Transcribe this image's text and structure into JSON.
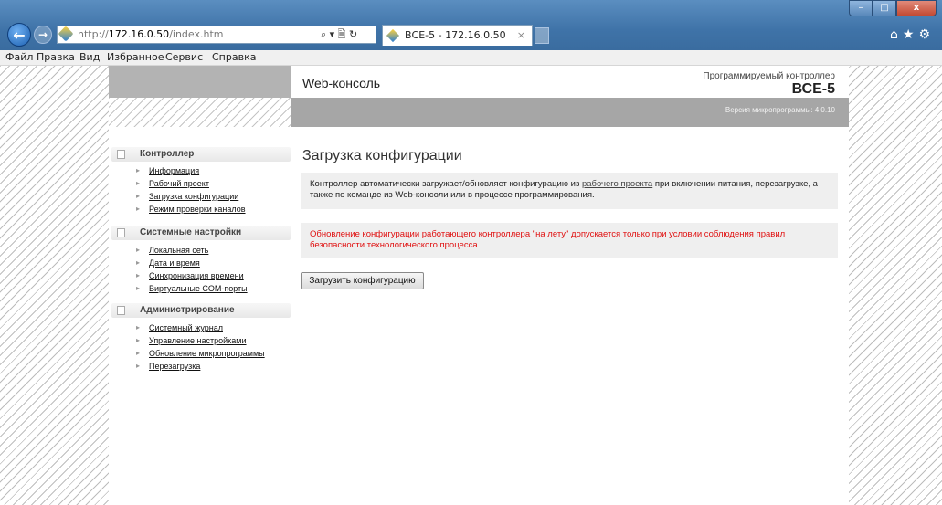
{
  "browser": {
    "url_prefix": "http://",
    "url_host": "172.16.0.50",
    "url_path": "/index.htm",
    "address_tools": "⌕ ▾ 🗎 ↻",
    "tab_title": "ВСЕ-5 - 172.16.0.50",
    "tab_close": "×",
    "back_icon": "arrow-left-icon",
    "forward_icon": "arrow-right-icon",
    "home_icon": "⌂",
    "favorites_icon": "★",
    "settings_icon": "⚙",
    "window_minimize": "–",
    "window_maximize": "□",
    "window_close": "x"
  },
  "menubar": {
    "items": [
      "Файл",
      "Правка",
      "Вид",
      "Избранное",
      "Сервис",
      "Справка"
    ]
  },
  "header": {
    "console_title": "Web-консоль",
    "controller_type": "Программируемый контроллер",
    "device_name": "ВСЕ-5",
    "firmware_version": "Версия микропрограммы: 4.0.10"
  },
  "sidebar": {
    "sections": [
      {
        "title": "Контроллер",
        "items": [
          "Информация",
          "Рабочий проект",
          "Загрузка конфигурации",
          "Режим проверки каналов"
        ]
      },
      {
        "title": "Системные настройки",
        "items": [
          "Локальная сеть",
          "Дата и время",
          "Синхронизация времени",
          "Виртуальные COM-порты"
        ]
      },
      {
        "title": "Администрирование",
        "items": [
          "Системный журнал",
          "Управление настройками",
          "Обновление микропрограммы",
          "Перезагрузка"
        ]
      }
    ]
  },
  "content": {
    "title": "Загрузка конфигурации",
    "info_part1": "Контроллер автоматически загружает/обновляет конфигурацию из ",
    "info_link": "рабочего проекта",
    "info_part2": " при включении питания, перезагрузке, а также по команде из Web-консоли или в процессе программирования.",
    "warning": "Обновление конфигурации работающего контроллера \"на лету\" допускается только при условии соблюдения правил безопасности технологического процесса.",
    "load_button": "Загрузить конфигурацию"
  },
  "colors": {
    "warning_text": "#e01010",
    "header_gray": "#a6a6a6",
    "box_background": "#efefef"
  }
}
